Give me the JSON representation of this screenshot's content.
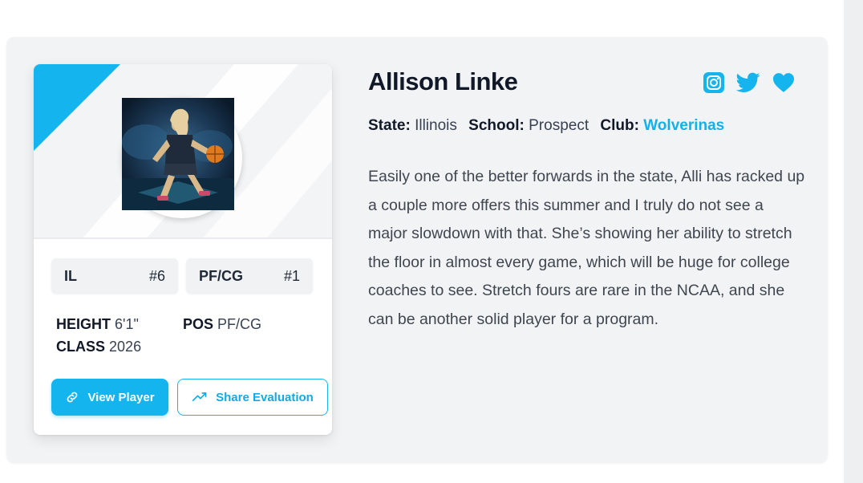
{
  "player": {
    "name": "Allison Linke",
    "state_label": "State:",
    "state": "Illinois",
    "school_label": "School:",
    "school": "Prospect",
    "club_label": "Club:",
    "club": "Wolverinas",
    "description": "Easily one of the better forwards in the state, Alli has racked up a couple more offers this summer and I truly do not see a major slowdown with that. She’s showing her ability to stretch the floor in almost every game, which will be huge for college coaches to see. Stretch fours are rare in the NCAA, and she can be another solid player for a program."
  },
  "card": {
    "tags": [
      {
        "code": "IL",
        "rank": "#6"
      },
      {
        "code": "PF/CG",
        "rank": "#1"
      }
    ],
    "stats": {
      "height_label": "HEIGHT",
      "height": "6'1\"",
      "pos_label": "POS",
      "pos": "PF/CG",
      "class_label": "CLASS",
      "class": "2026"
    },
    "buttons": {
      "view_player": "View Player",
      "share_evaluation": "Share Evaluation"
    }
  },
  "socials": [
    "instagram-icon",
    "twitter-icon",
    "heart-icon"
  ],
  "colors": {
    "accent": "#14b4ee",
    "panel_bg": "#f2f3f5",
    "text_dark": "#111827"
  }
}
